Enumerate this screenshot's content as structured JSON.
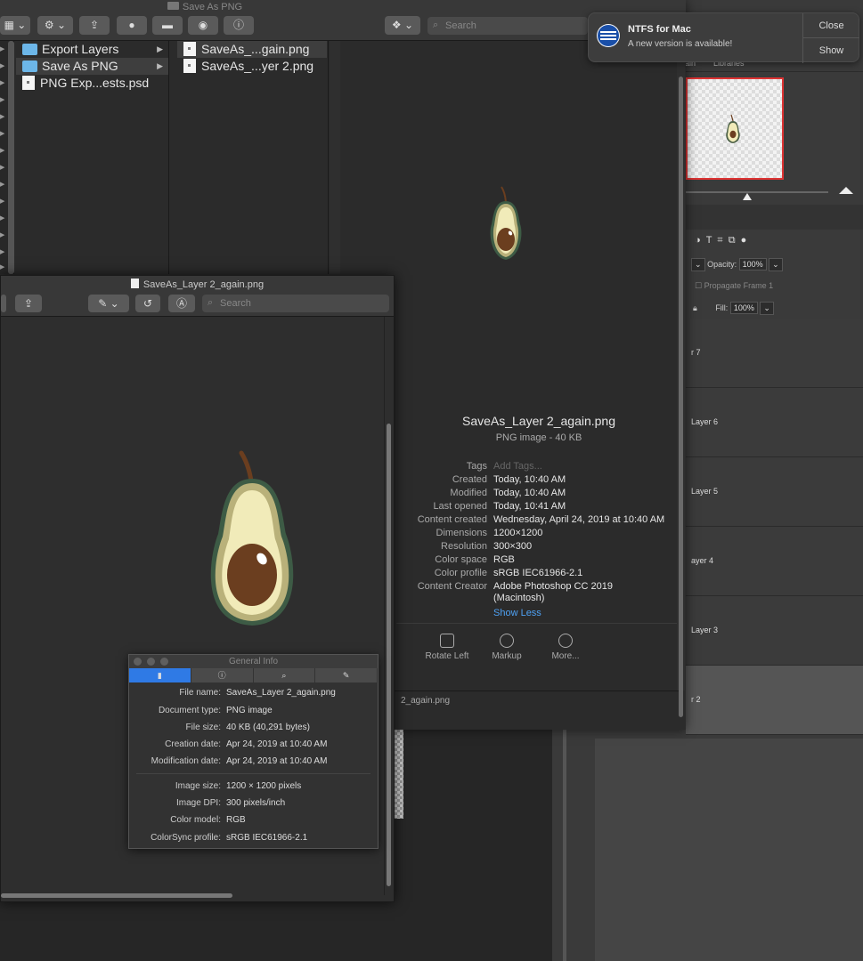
{
  "finder": {
    "window_title": "Save As PNG",
    "search_placeholder": "Search",
    "sidebar_items": [
      {
        "label": "Export Layers",
        "kind": "folder"
      },
      {
        "label": "Save As PNG",
        "kind": "folder"
      },
      {
        "label": "PNG Exp...ests.psd",
        "kind": "file"
      }
    ],
    "files": [
      {
        "label": "SaveAs_...gain.png"
      },
      {
        "label": "SaveAs_...yer 2.png"
      }
    ],
    "preview": {
      "file_name": "SaveAs_Layer 2_again.png",
      "subtitle": "PNG image - 40 KB",
      "tags_label": "Tags",
      "tags_placeholder": "Add Tags...",
      "metadata": [
        {
          "key": "Created",
          "value": "Today, 10:40 AM"
        },
        {
          "key": "Modified",
          "value": "Today, 10:40 AM"
        },
        {
          "key": "Last opened",
          "value": "Today, 10:41 AM"
        },
        {
          "key": "Content created",
          "value": "Wednesday, April 24, 2019 at 10:40 AM"
        },
        {
          "key": "Dimensions",
          "value": "1200×1200"
        },
        {
          "key": "Resolution",
          "value": "300×300"
        },
        {
          "key": "Color space",
          "value": "RGB"
        },
        {
          "key": "Color profile",
          "value": "sRGB IEC61966-2.1"
        },
        {
          "key": "Content Creator",
          "value": "Adobe Photoshop CC 2019"
        },
        {
          "key": "",
          "value": "(Macintosh)"
        }
      ],
      "show_less": "Show Less",
      "actions": [
        "Rotate Left",
        "Markup",
        "More..."
      ]
    },
    "path_bar": "2_again.png"
  },
  "notification": {
    "title": "NTFS for Mac",
    "text": "A new version is available!",
    "close_label": "Close",
    "show_label": "Show"
  },
  "preview_app": {
    "window_title": "SaveAs_Layer 2_again.png",
    "search_placeholder": "Search"
  },
  "general_info": {
    "title": "General Info",
    "rows": [
      {
        "key": "File name:",
        "value": "SaveAs_Layer 2_again.png"
      },
      {
        "key": "Document type:",
        "value": "PNG image"
      },
      {
        "key": "File size:",
        "value": "40 KB (40,291 bytes)"
      },
      {
        "key": "Creation date:",
        "value": "Apr 24, 2019 at 10:40 AM"
      },
      {
        "key": "Modification date:",
        "value": "Apr 24, 2019 at 10:40 AM"
      }
    ],
    "image_rows": [
      {
        "key": "Image size:",
        "value": "1200 × 1200 pixels"
      },
      {
        "key": "Image DPI:",
        "value": "300 pixels/inch"
      },
      {
        "key": "Color model:",
        "value": "RGB"
      },
      {
        "key": "ColorSync profile:",
        "value": "sRGB IEC61966-2.1"
      }
    ]
  },
  "photoshop": {
    "tabs": [
      "ain",
      "Libraries"
    ],
    "opacity_label": "Opacity:",
    "opacity_value": "100%",
    "propagate_label": "Propagate Frame 1",
    "fill_label": "Fill:",
    "fill_value": "100%",
    "layers": [
      "r 7",
      "Layer 6",
      "Layer 5",
      "ayer 4",
      "Layer 3",
      "r 2"
    ]
  }
}
